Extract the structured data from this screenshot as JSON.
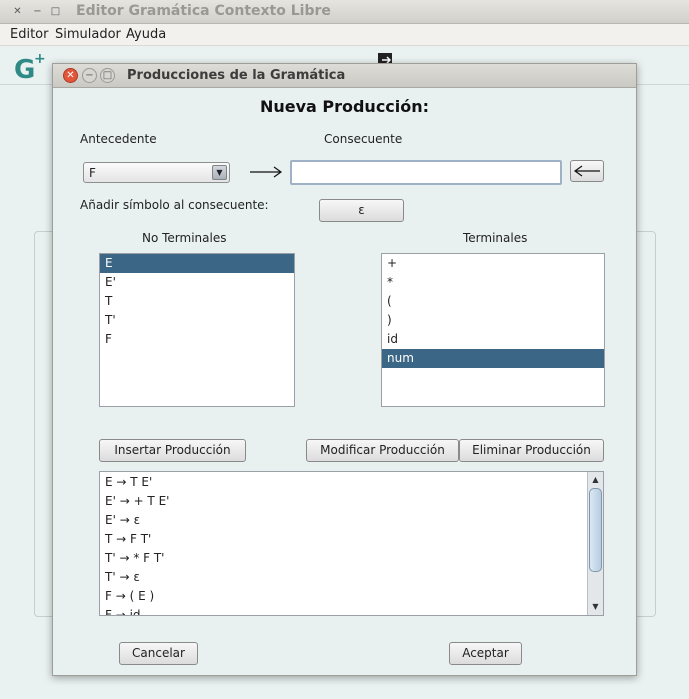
{
  "main_window": {
    "title": "Editor Gramática Contexto Libre",
    "menu": [
      "Editor",
      "Simulador",
      "Ayuda"
    ]
  },
  "dialog": {
    "title": "Producciones de la Gramática",
    "heading": "Nueva Producción:",
    "antecedente_label": "Antecedente",
    "consecuente_label": "Consecuente",
    "antecedente_selected": "F",
    "consecuente_value": "",
    "add_symbol_label": "Añadir símbolo al consecuente:",
    "epsilon_button": "ε",
    "no_terminales_label": "No Terminales",
    "terminales_label": "Terminales",
    "no_terminales": [
      "E",
      "E'",
      "T",
      "T'",
      "F"
    ],
    "no_terminales_selected": "E",
    "terminales": [
      "+",
      "*",
      "(",
      ")",
      "id",
      "num"
    ],
    "terminales_selected": "num",
    "insert_button": "Insertar Producción",
    "modify_button": "Modificar Producción",
    "delete_button": "Eliminar Producción",
    "productions": [
      "E → T E'",
      "E' → + T E'",
      "E' → ε",
      "T → F T'",
      "T' → * F T'",
      "T' → ε",
      "F → ( E )",
      "F → id"
    ],
    "cancel_button": "Cancelar",
    "accept_button": "Aceptar"
  },
  "colors": {
    "selection": "#3b6685",
    "window_bg": "#e8f1f0",
    "close_button": "#e2563b"
  }
}
